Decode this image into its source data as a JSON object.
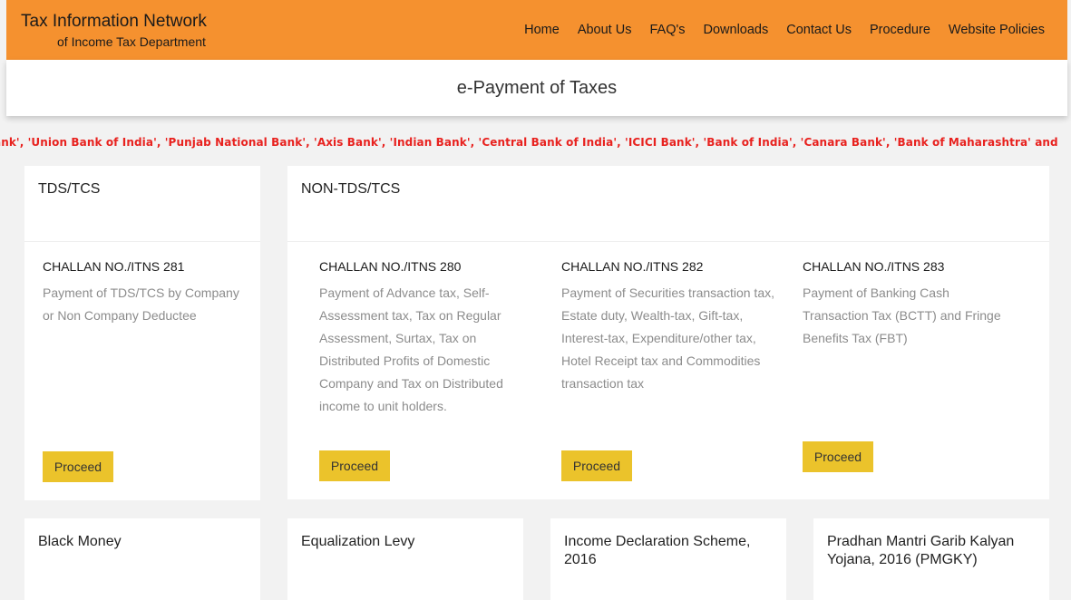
{
  "header": {
    "brand_title": "Tax Information Network",
    "brand_subtitle": "of Income Tax Department",
    "nav": [
      "Home",
      "About Us",
      "FAQ's",
      "Downloads",
      "Contact Us",
      "Procedure",
      "Website Policies"
    ]
  },
  "page_title": "e-Payment of Taxes",
  "ticker": "ank', 'Union Bank of India', 'Punjab National Bank', 'Axis Bank', 'Indian Bank', 'Central Bank of India', 'ICICI Bank', 'Bank of India', 'Canara Bank', 'Bank of Maharashtra' and",
  "tds_card": {
    "title": "TDS/TCS",
    "challan": "CHALLAN NO./ITNS 281",
    "desc": "Payment of TDS/TCS by Company or Non Company Deductee",
    "button": "Proceed"
  },
  "non_tds_card": {
    "title": "NON-TDS/TCS",
    "items": [
      {
        "challan": "CHALLAN NO./ITNS 280",
        "desc": "Payment of Advance tax, Self-Assessment tax, Tax on Regular Assessment, Surtax, Tax on Distributed Profits of Domestic Company and Tax on Distributed income to unit holders.",
        "button": "Proceed"
      },
      {
        "challan": "CHALLAN NO./ITNS 282",
        "desc": "Payment of Securities transaction tax, Estate duty, Wealth-tax, Gift-tax, Interest-tax, Expenditure/other tax, Hotel Receipt tax and Commodities transaction tax",
        "button": "Proceed"
      },
      {
        "challan": "CHALLAN NO./ITNS 283",
        "desc": "Payment of Banking Cash Transaction Tax (BCTT) and Fringe Benefits Tax (FBT)",
        "button": "Proceed"
      }
    ]
  },
  "bottom_cards": [
    "Black Money",
    "Equalization Levy",
    "Income Declaration Scheme, 2016",
    "Pradhan Mantri Garib Kalyan Yojana, 2016 (PMGKY)"
  ]
}
